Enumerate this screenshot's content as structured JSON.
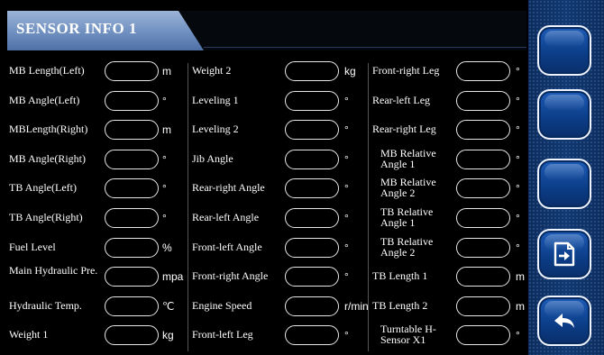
{
  "header": {
    "title": "SENSOR INFO 1"
  },
  "columns": [
    [
      {
        "label": "MB Length(Left)",
        "value": "",
        "unit": "m"
      },
      {
        "label": "MB Angle(Left)",
        "value": "",
        "unit": "°"
      },
      {
        "label": "MBLength(Right)",
        "value": "",
        "unit": "m"
      },
      {
        "label": "MB Angle(Right)",
        "value": "",
        "unit": "°"
      },
      {
        "label": "TB Angle(Left)",
        "value": "",
        "unit": "°"
      },
      {
        "label": "TB Angle(Right)",
        "value": "",
        "unit": "°"
      },
      {
        "label": "Fuel Level",
        "value": "",
        "unit": "%"
      },
      {
        "label": "Main Hydraulic Pre.",
        "value": "",
        "unit": "mpa"
      },
      {
        "label": "Hydraulic Temp.",
        "value": "",
        "unit": "℃"
      },
      {
        "label": "Weight 1",
        "value": "",
        "unit": "kg"
      }
    ],
    [
      {
        "label": "Weight 2",
        "value": "",
        "unit": "kg"
      },
      {
        "label": "Leveling 1",
        "value": "",
        "unit": "°"
      },
      {
        "label": "Leveling 2",
        "value": "",
        "unit": "°"
      },
      {
        "label": "Jib Angle",
        "value": "",
        "unit": "°"
      },
      {
        "label": "Rear-right Angle",
        "value": "",
        "unit": "°"
      },
      {
        "label": "Rear-left Angle",
        "value": "",
        "unit": "°"
      },
      {
        "label": "Front-left Angle",
        "value": "",
        "unit": "°"
      },
      {
        "label": "Front-right Angle",
        "value": "",
        "unit": "°"
      },
      {
        "label": "Engine Speed",
        "value": "",
        "unit": "r/min"
      },
      {
        "label": "Front-left Leg",
        "value": "",
        "unit": "°"
      }
    ],
    [
      {
        "label": "Front-right Leg",
        "value": "",
        "unit": "°"
      },
      {
        "label": "Rear-left Leg",
        "value": "",
        "unit": "°"
      },
      {
        "label": "Rear-right Leg",
        "value": "",
        "unit": "°"
      },
      {
        "label": "MB Relative Angle 1",
        "value": "",
        "unit": "°"
      },
      {
        "label": "MB Relative Angle 2",
        "value": "",
        "unit": "°"
      },
      {
        "label": "TB Relative Angle 1",
        "value": "",
        "unit": "°"
      },
      {
        "label": "TB Relative Angle 2",
        "value": "",
        "unit": "°"
      },
      {
        "label": "TB Length 1",
        "value": "",
        "unit": "m"
      },
      {
        "label": "TB Length 2",
        "value": "",
        "unit": "m"
      },
      {
        "label": "Turntable H-Sensor X1",
        "value": "",
        "unit": "°"
      }
    ]
  ],
  "side_buttons": [
    {
      "icon": "blank"
    },
    {
      "icon": "blank"
    },
    {
      "icon": "blank"
    },
    {
      "icon": "export-icon"
    },
    {
      "icon": "back-arrow-icon"
    }
  ],
  "colors": {
    "accent": "#12386f",
    "title_tab": "#6f8fc0",
    "field_border": "#e8e8e8"
  }
}
